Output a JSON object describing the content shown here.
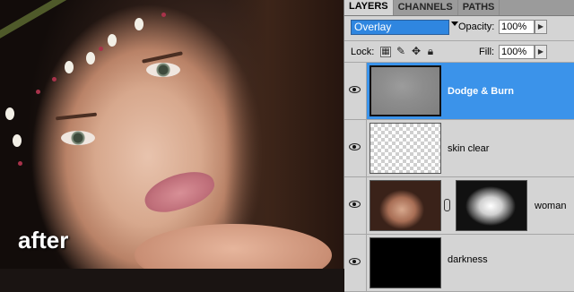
{
  "photo": {
    "label": "after"
  },
  "panel": {
    "tabs": [
      {
        "label": "LAYERS",
        "active": true
      },
      {
        "label": "CHANNELS",
        "active": false
      },
      {
        "label": "PATHS",
        "active": false
      }
    ],
    "blend_mode": "Overlay",
    "opacity_label": "Opacity:",
    "opacity_value": "100%",
    "lock_label": "Lock:",
    "lock_icons": [
      "lock-transparent-icon",
      "lock-brush-icon",
      "lock-move-icon",
      "lock-all-icon"
    ],
    "fill_label": "Fill:",
    "fill_value": "100%",
    "layers": [
      {
        "name": "Dodge & Burn",
        "selected": true,
        "thumbnail": "gray-fill",
        "visible": true
      },
      {
        "name": "skin clear",
        "selected": false,
        "thumbnail": "transparent",
        "visible": true
      },
      {
        "name": "woman",
        "selected": false,
        "thumbnail": "photo",
        "has_mask": true,
        "visible": true
      },
      {
        "name": "darkness",
        "selected": false,
        "thumbnail": "black",
        "visible": true
      }
    ],
    "selection_color": "#3b93ea"
  }
}
